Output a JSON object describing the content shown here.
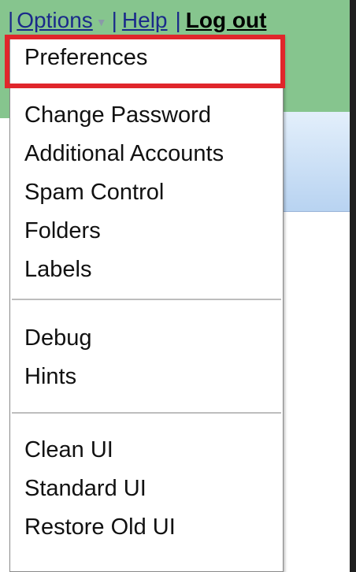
{
  "nav": {
    "sep1": "|",
    "options": "Options",
    "options_caret_icon": "caret-down-icon",
    "sep2": "|",
    "help": "Help",
    "sep3": "|",
    "logout": "Log out"
  },
  "menu": {
    "group1": [
      "Preferences"
    ],
    "group2": [
      "Change Password",
      "Additional Accounts",
      "Spam Control",
      "Folders",
      "Labels"
    ],
    "group3": [
      "Debug",
      "Hints"
    ],
    "group4": [
      "Clean UI",
      "Standard UI",
      "Restore Old UI"
    ]
  },
  "colors": {
    "header_green": "#86c58e",
    "highlight_red": "#e0262b",
    "panel_blue": "#b8d3f1"
  }
}
